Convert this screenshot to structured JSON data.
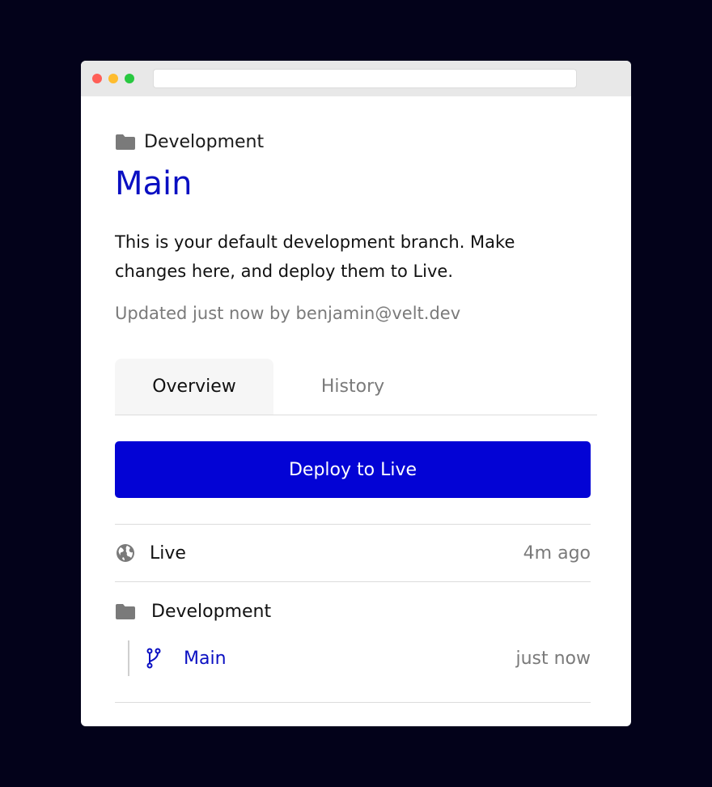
{
  "header": {
    "breadcrumb_label": "Development",
    "title": "Main",
    "description": "This is your default development branch. Make changes here, and deploy them to Live.",
    "updated": "Updated just now by benjamin@velt.dev"
  },
  "tabs": [
    {
      "label": "Overview",
      "active": true
    },
    {
      "label": "History",
      "active": false
    }
  ],
  "deploy_button": {
    "label": "Deploy to Live"
  },
  "environments": {
    "live": {
      "label": "Live",
      "time": "4m ago",
      "icon": "globe-icon"
    },
    "development": {
      "label": "Development",
      "icon": "folder-icon",
      "branches": [
        {
          "label": "Main",
          "time": "just now",
          "icon": "branch-icon"
        }
      ]
    }
  },
  "colors": {
    "accent": "#0a0fc2",
    "button": "#0303d5",
    "background": "#03021a",
    "muted": "#7a7a7a"
  }
}
